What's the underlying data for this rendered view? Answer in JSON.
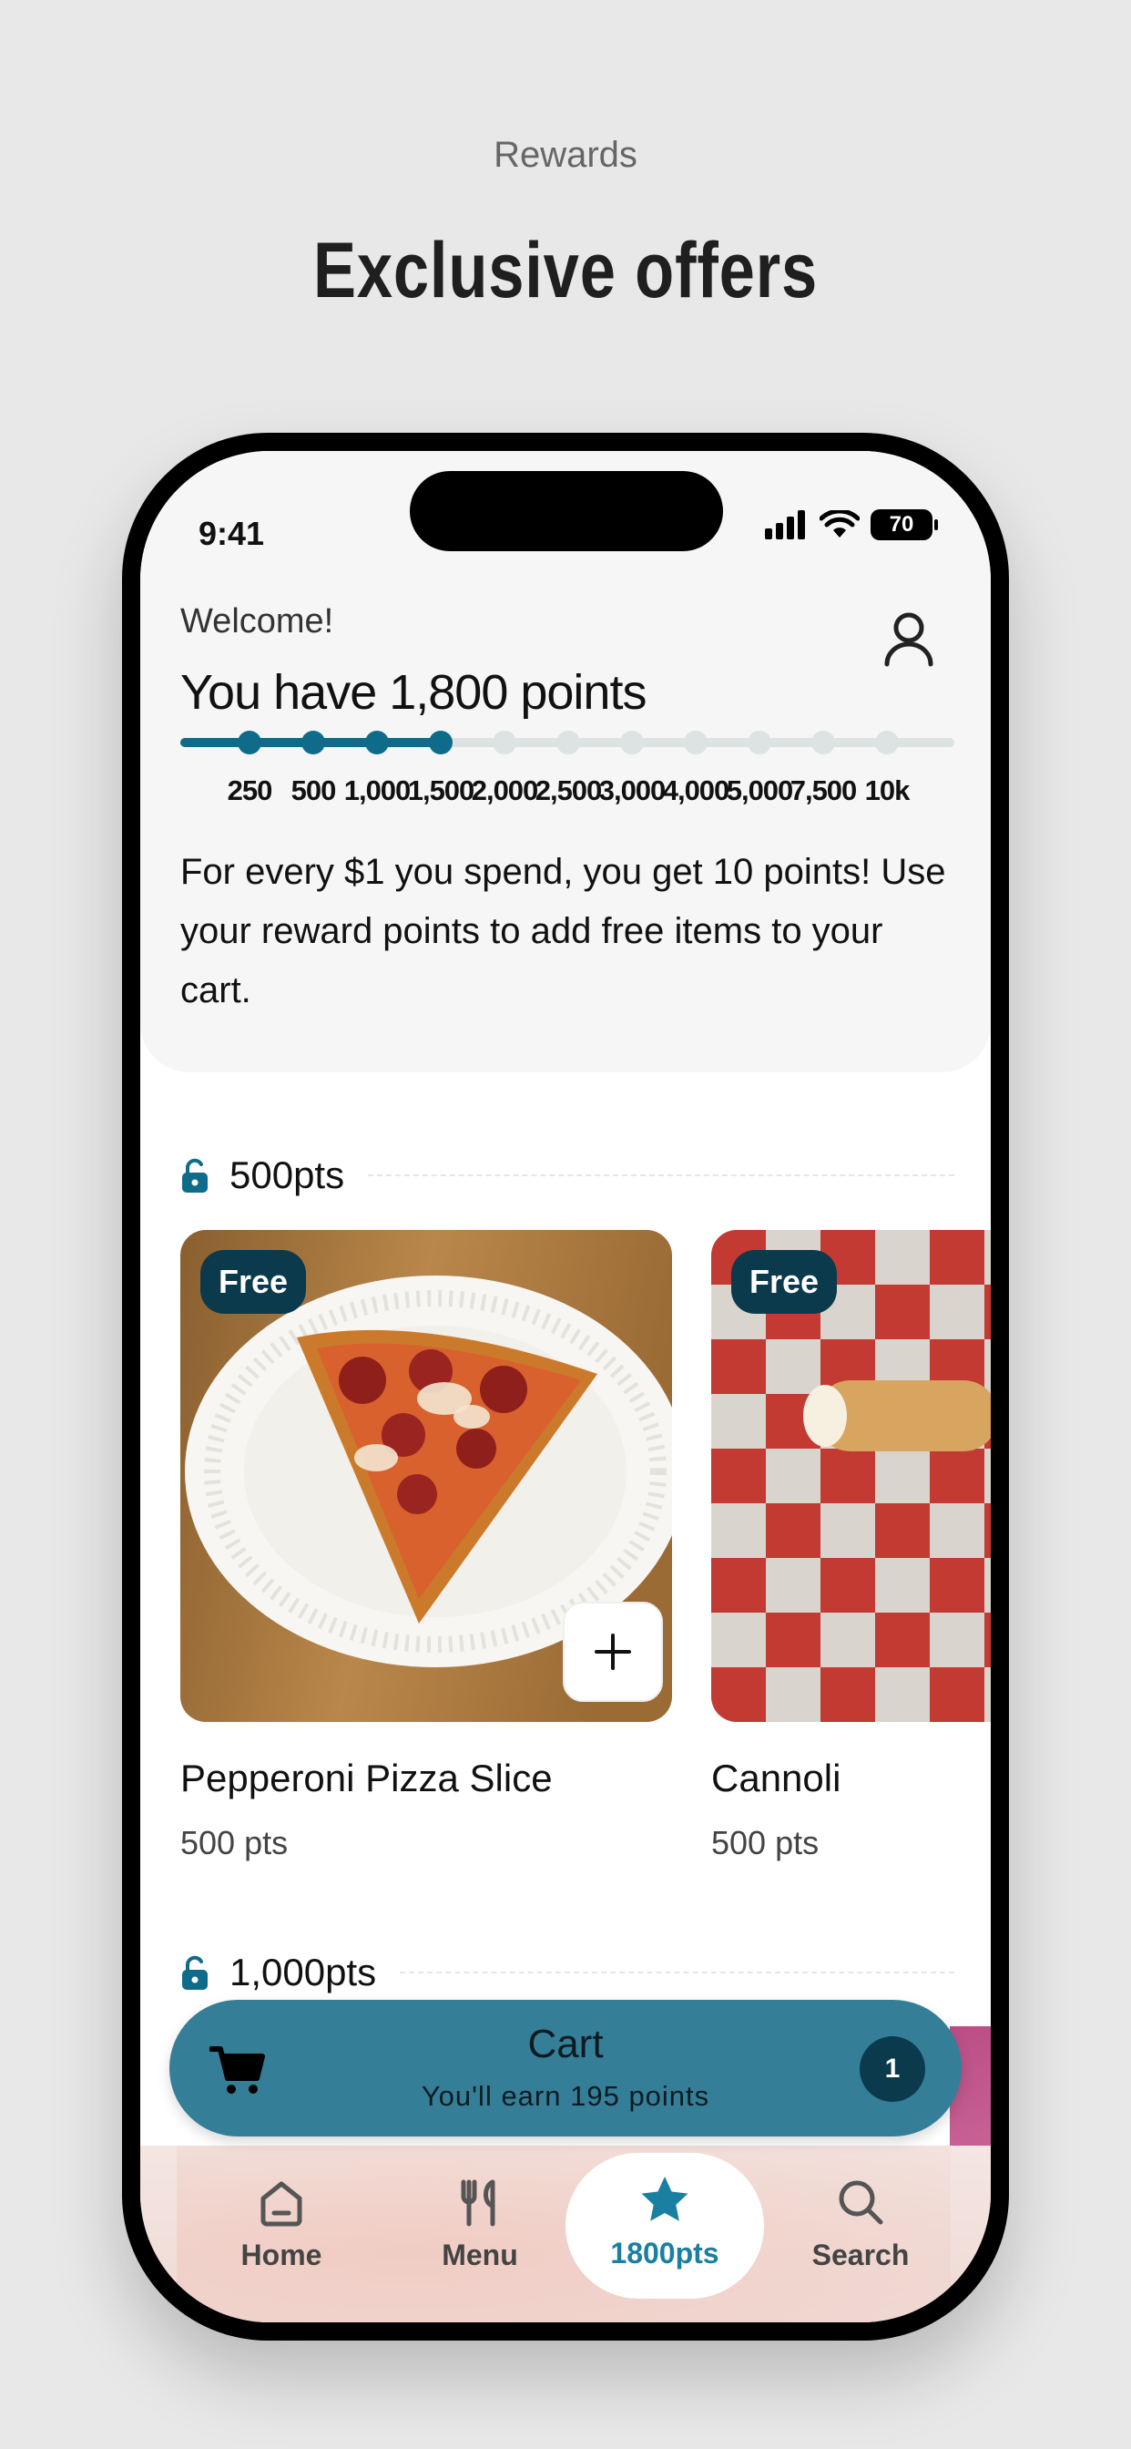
{
  "promo": {
    "eyebrow": "Rewards",
    "title": "Exclusive offers"
  },
  "status_bar": {
    "time": "9:41",
    "battery": "70"
  },
  "header": {
    "welcome": "Welcome!",
    "points_title": "You have 1,800 points",
    "current_points": 1800,
    "milestones": [
      "250",
      "500",
      "1,000",
      "1,500",
      "2,000",
      "2,500",
      "3,000",
      "4,000",
      "5,000",
      "7,500",
      "10k"
    ],
    "milestones_reached": 4,
    "rules": "For every $1 you spend, you get 10 points! Use your reward points to add free items to your cart."
  },
  "tiers": [
    {
      "label": "500pts",
      "icon": "unlock-icon"
    },
    {
      "label": "1,000pts",
      "icon": "unlock-icon"
    }
  ],
  "rewards": [
    {
      "badge": "Free",
      "name": "Pepperoni Pizza Slice",
      "points": "500 pts"
    },
    {
      "badge": "Free",
      "name": "Cannoli",
      "points": "500 pts"
    }
  ],
  "cart": {
    "title": "Cart",
    "subtitle": "You'll earn 195 points",
    "count": "1"
  },
  "nav": {
    "items": [
      {
        "label": "Home",
        "icon": "home-icon"
      },
      {
        "label": "Menu",
        "icon": "utensils-icon"
      },
      {
        "label": "1800pts",
        "icon": "star-icon"
      },
      {
        "label": "Search",
        "icon": "search-icon"
      }
    ],
    "active_color": "#1a7fa0"
  },
  "colors": {
    "accent": "#0f6b8a",
    "cart_bar": "#357e98",
    "badge": "#0b3a4d"
  }
}
